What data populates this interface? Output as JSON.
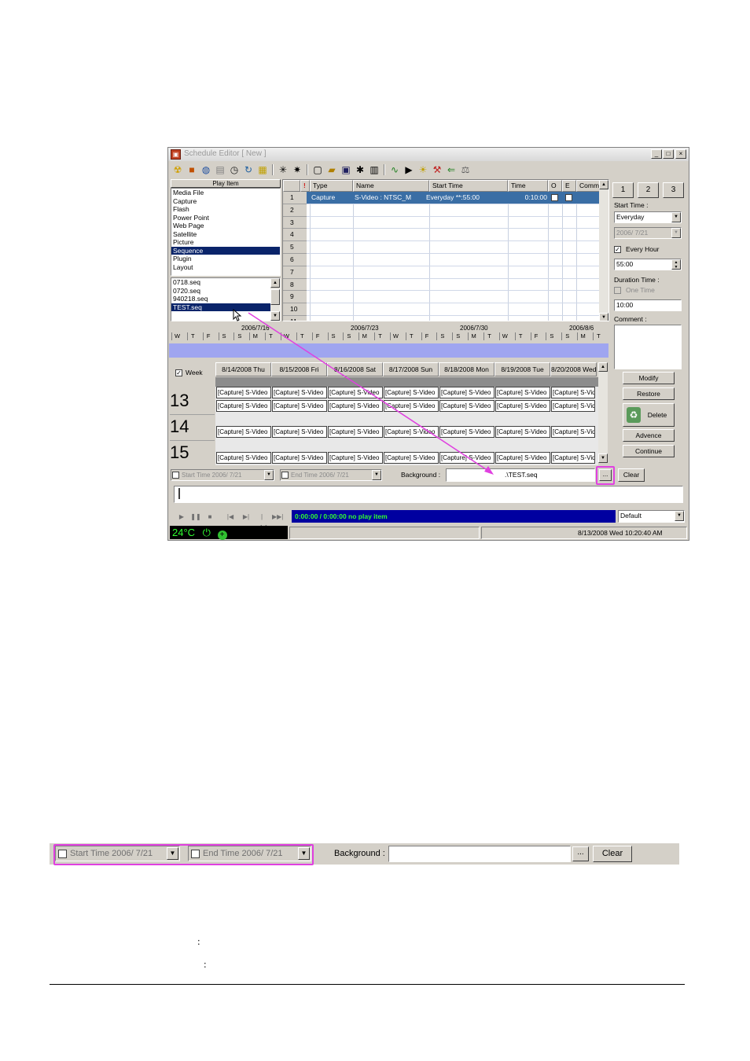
{
  "window": {
    "title": "Schedule Editor [ New ]",
    "controls": [
      "_",
      "□",
      "×"
    ]
  },
  "play_item": {
    "header": "Play Item",
    "items": [
      "Media File",
      "Capture",
      "Flash",
      "Power Point",
      "Web Page",
      "Satellite",
      "Picture",
      "Sequence",
      "Plugin",
      "Layout"
    ],
    "selected": "Sequence",
    "files": [
      "0718.seq",
      "0720.seq",
      "940218.seq",
      "TEST.seq"
    ],
    "selected_file": "TEST.seq"
  },
  "grid": {
    "headers": [
      "!",
      "Type",
      "Name",
      "Start Time",
      "Time",
      "O",
      "E",
      "Comm"
    ],
    "rows": [
      {
        "num": "1",
        "type": "Capture",
        "name": "S-Video : NTSC_M",
        "start": "Everyday  **:55:00",
        "time": "0:10:00"
      },
      {
        "num": "2"
      },
      {
        "num": "3"
      },
      {
        "num": "4"
      },
      {
        "num": "5"
      },
      {
        "num": "6"
      },
      {
        "num": "7"
      },
      {
        "num": "8"
      },
      {
        "num": "9"
      },
      {
        "num": "10"
      },
      {
        "num": "11"
      }
    ]
  },
  "right_panel": {
    "tabs": [
      "1",
      "2",
      "3"
    ],
    "start_time_label": "Start Time :",
    "start_mode": "Everyday",
    "start_date": "2006/  7/21",
    "every_hour_label": "Every Hour",
    "start_value": "55:00",
    "duration_label": "Duration Time :",
    "one_time_label": "One Time",
    "duration_value": "10:00",
    "comment_label": "Comment :",
    "buttons": [
      "Modify",
      "Restore",
      "Delete",
      "Advence",
      "Continue"
    ]
  },
  "timeline": {
    "dates": [
      "2006/7/16",
      "2006/7/23",
      "2006/7/30",
      "2006/8/6"
    ],
    "days": [
      "W",
      "T",
      "F",
      "S",
      "S",
      "M",
      "T",
      "W",
      "T",
      "F",
      "S",
      "S",
      "M",
      "T",
      "W",
      "T",
      "F",
      "S",
      "S",
      "M",
      "T",
      "W",
      "T",
      "F",
      "S",
      "S",
      "M",
      "T",
      "W",
      "T",
      "F",
      "S",
      "S",
      "M",
      "T",
      "W",
      "T",
      "F",
      "S",
      "S"
    ]
  },
  "week_view": {
    "week_label": "Week",
    "days": [
      "8/14/2008 Thu",
      "8/15/2008 Fri",
      "8/16/2008 Sat",
      "8/17/2008 Sun",
      "8/18/2008 Mon",
      "8/19/2008 Tue",
      "8/20/2008 Wed"
    ],
    "hours": [
      "13",
      "14",
      "15"
    ],
    "event_label": "[Capture] S-Video"
  },
  "bottom": {
    "start_time": "Start Time 2006/  7/21",
    "end_time": "End Time 2006/  7/21",
    "background_label": "Background :",
    "background_value": ".\\TEST.seq",
    "browse": "...",
    "clear": "Clear",
    "lcd": "0:00:00 / 0:00:00   no play item",
    "preset": "Default",
    "temperature": "24°C",
    "datetime": "8/13/2008 Wed 10:20:40 AM"
  },
  "zoom_strip": {
    "start_time": "Start Time 2006/  7/21",
    "end_time": "End Time 2006/  7/21",
    "background_label": "Background :",
    "background_value": "",
    "browse": "...",
    "clear": "Clear"
  },
  "doc": {
    "colon_1": ":",
    "colon_2": ":"
  },
  "colors": {
    "highlight": "#e040e0",
    "selection": "#0a246a",
    "lcd_bg": "#0000a0",
    "lcd_text": "#30ff30",
    "timebar": "#9fa5f0"
  }
}
